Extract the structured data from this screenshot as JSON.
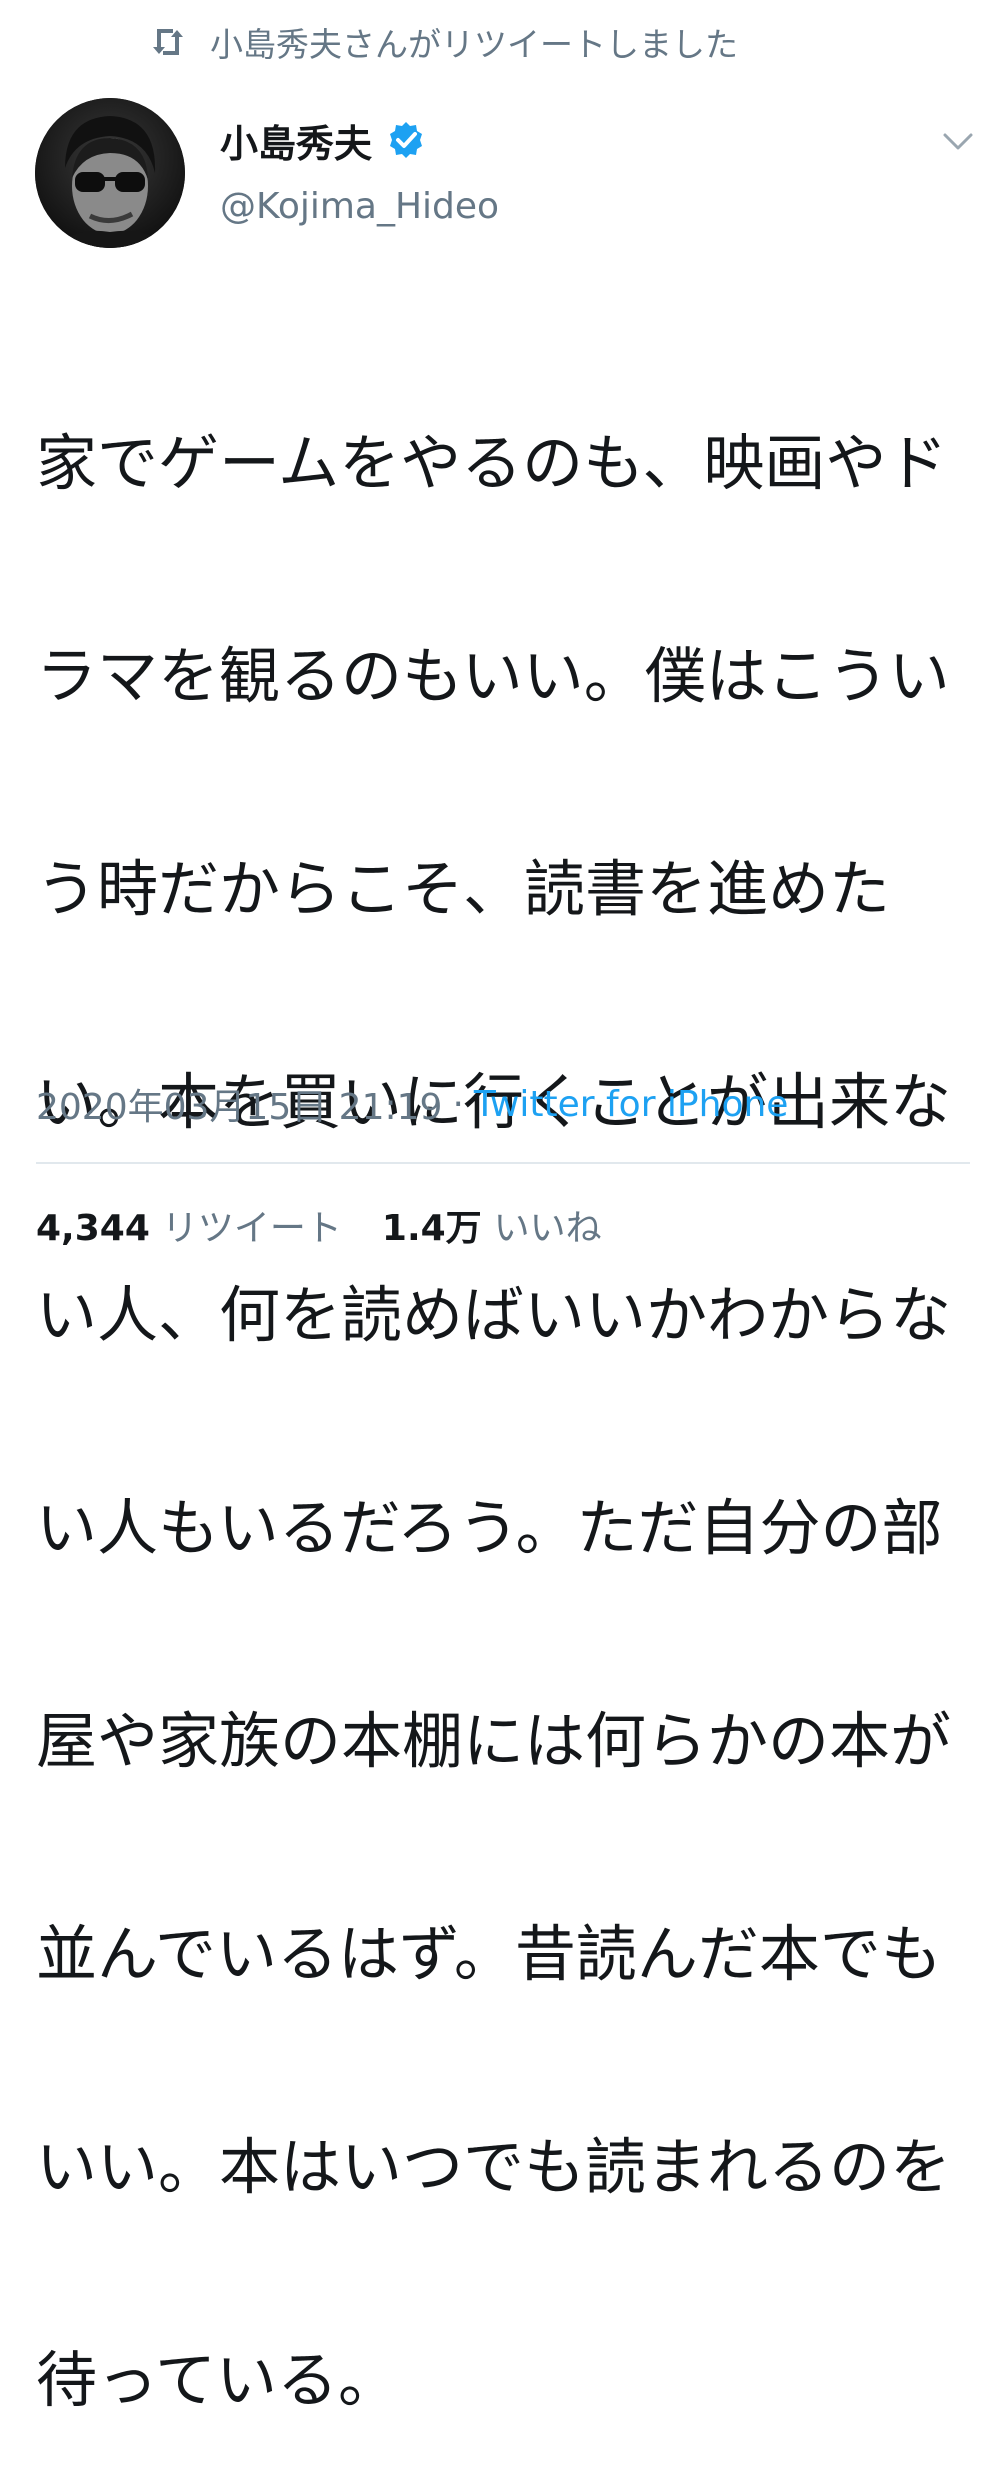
{
  "retweet_banner": {
    "icon": "retweet-icon",
    "text": "小島秀夫さんがリツイートしました"
  },
  "author": {
    "name": "小島秀夫",
    "handle": "@Kojima_Hideo",
    "verified": true,
    "verified_icon": "verified-badge-icon"
  },
  "menu_icon": "chevron-down-icon",
  "tweet": {
    "lines": [
      "家でゲームをやるのも、映画やド",
      "ラマを観るのもいい。僕はこうい",
      "う時だからこそ、読書を進めた",
      "い。本を買いに行くことが出来な",
      "い人、何を読めばいいかわからな",
      "い人もいるだろう。ただ自分の部",
      "屋や家族の本棚には何らかの本が",
      "並んでいるはず。昔読んだ本でも",
      "いい。本はいつでも読まれるのを",
      "待っている。"
    ],
    "timestamp": "2020年03月15日 21:19",
    "separator": "·",
    "source": "Twitter for iPhone"
  },
  "stats": {
    "retweets_count": "4,344",
    "retweets_label": "リツイート",
    "likes_count": "1.4万",
    "likes_label": "いいね"
  },
  "colors": {
    "accent": "#1da1f2",
    "secondary_text": "#657786",
    "primary_text": "#14171a",
    "divider": "#e1e8ed"
  }
}
